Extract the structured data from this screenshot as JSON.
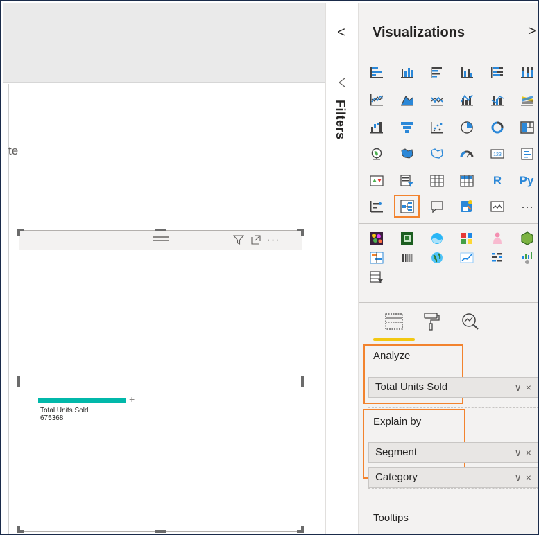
{
  "canvas": {
    "partial_text": "te",
    "visual": {
      "bar_label": "Total Units Sold",
      "bar_value": "675368",
      "bar_color": "#01b8aa"
    }
  },
  "filters": {
    "label": "Filters",
    "collapse_glyph": "<"
  },
  "visualizations": {
    "title": "Visualizations",
    "expand_glyph": ">",
    "r_label": "R",
    "py_label": "Py",
    "more_glyph": "···",
    "selected_visual": "key-influencers-icon",
    "accent": "#f2832e"
  },
  "fields": {
    "analyze_label": "Analyze",
    "analyze_value": "Total Units Sold",
    "explain_label": "Explain by",
    "explain_values": [
      "Segment",
      "Category"
    ],
    "tooltips_label": "Tooltips",
    "pill_controls": "∨×"
  }
}
